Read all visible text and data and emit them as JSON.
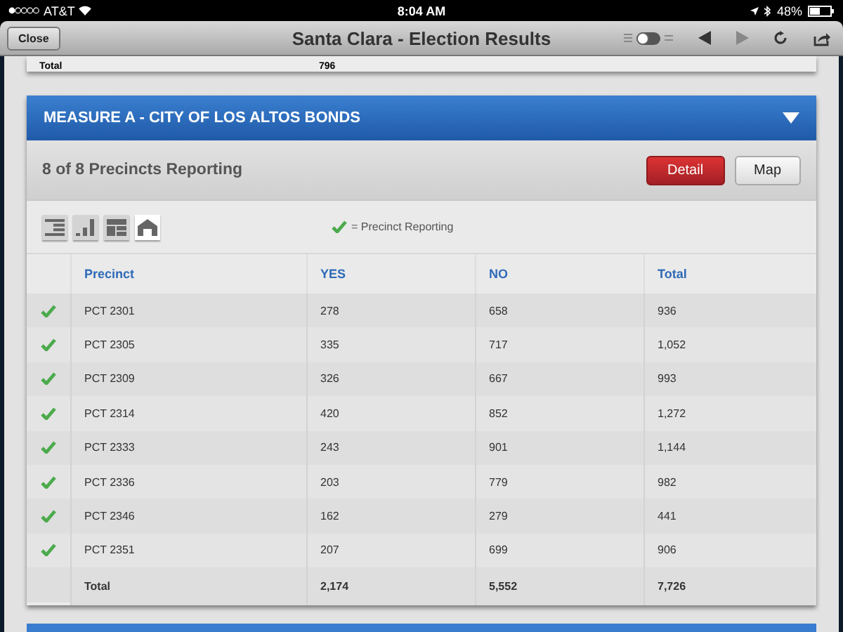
{
  "status_bar": {
    "carrier": "AT&T",
    "time": "8:04 AM",
    "battery": "48%"
  },
  "nav_bar": {
    "close": "Close",
    "title": "Santa Clara - Election Results",
    "toggle": {
      "on": false
    }
  },
  "previous_card": {
    "total_label": "Total",
    "total_value": "796"
  },
  "measure": {
    "title": "MEASURE A - CITY OF LOS ALTOS BONDS",
    "expanded": true,
    "reporting": "8 of 8 Precincts Reporting",
    "buttons": [
      {
        "label": "Detail",
        "kind": "primary"
      },
      {
        "label": "Map",
        "kind": "plain"
      }
    ],
    "views": [
      {
        "kind": "list",
        "selected": false
      },
      {
        "kind": "bars",
        "selected": false
      },
      {
        "kind": "grid",
        "selected": false
      },
      {
        "kind": "home",
        "selected": true
      }
    ],
    "legend": "= Precinct Reporting",
    "table": {
      "columns": [
        "Precinct",
        "YES",
        "NO",
        "Total"
      ],
      "rows": [
        {
          "reporting": true,
          "cells": [
            "PCT 2301",
            "278",
            "658",
            "936"
          ]
        },
        {
          "reporting": true,
          "cells": [
            "PCT 2305",
            "335",
            "717",
            "1,052"
          ]
        },
        {
          "reporting": true,
          "cells": [
            "PCT 2309",
            "326",
            "667",
            "993"
          ]
        },
        {
          "reporting": true,
          "cells": [
            "PCT 2314",
            "420",
            "852",
            "1,272"
          ]
        },
        {
          "reporting": true,
          "cells": [
            "PCT 2333",
            "243",
            "901",
            "1,144"
          ]
        },
        {
          "reporting": true,
          "cells": [
            "PCT 2336",
            "203",
            "779",
            "982"
          ]
        },
        {
          "reporting": true,
          "cells": [
            "PCT 2346",
            "162",
            "279",
            "441"
          ]
        },
        {
          "reporting": true,
          "cells": [
            "PCT 2351",
            "207",
            "699",
            "906"
          ]
        }
      ],
      "total": [
        "Total",
        "2,174",
        "5,552",
        "7,726"
      ]
    }
  }
}
